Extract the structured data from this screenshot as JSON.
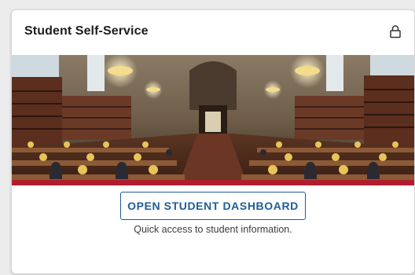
{
  "card": {
    "title": "Student Self-Service",
    "lock_icon": "lock-icon",
    "image_alt_icon": "library-reading-room-photo",
    "button_label": "OPEN STUDENT DASHBOARD",
    "description": "Quick access to student information."
  },
  "colors": {
    "accent": "#b01e2e",
    "button_border": "#1f5c99",
    "button_text": "#1f5c99"
  }
}
